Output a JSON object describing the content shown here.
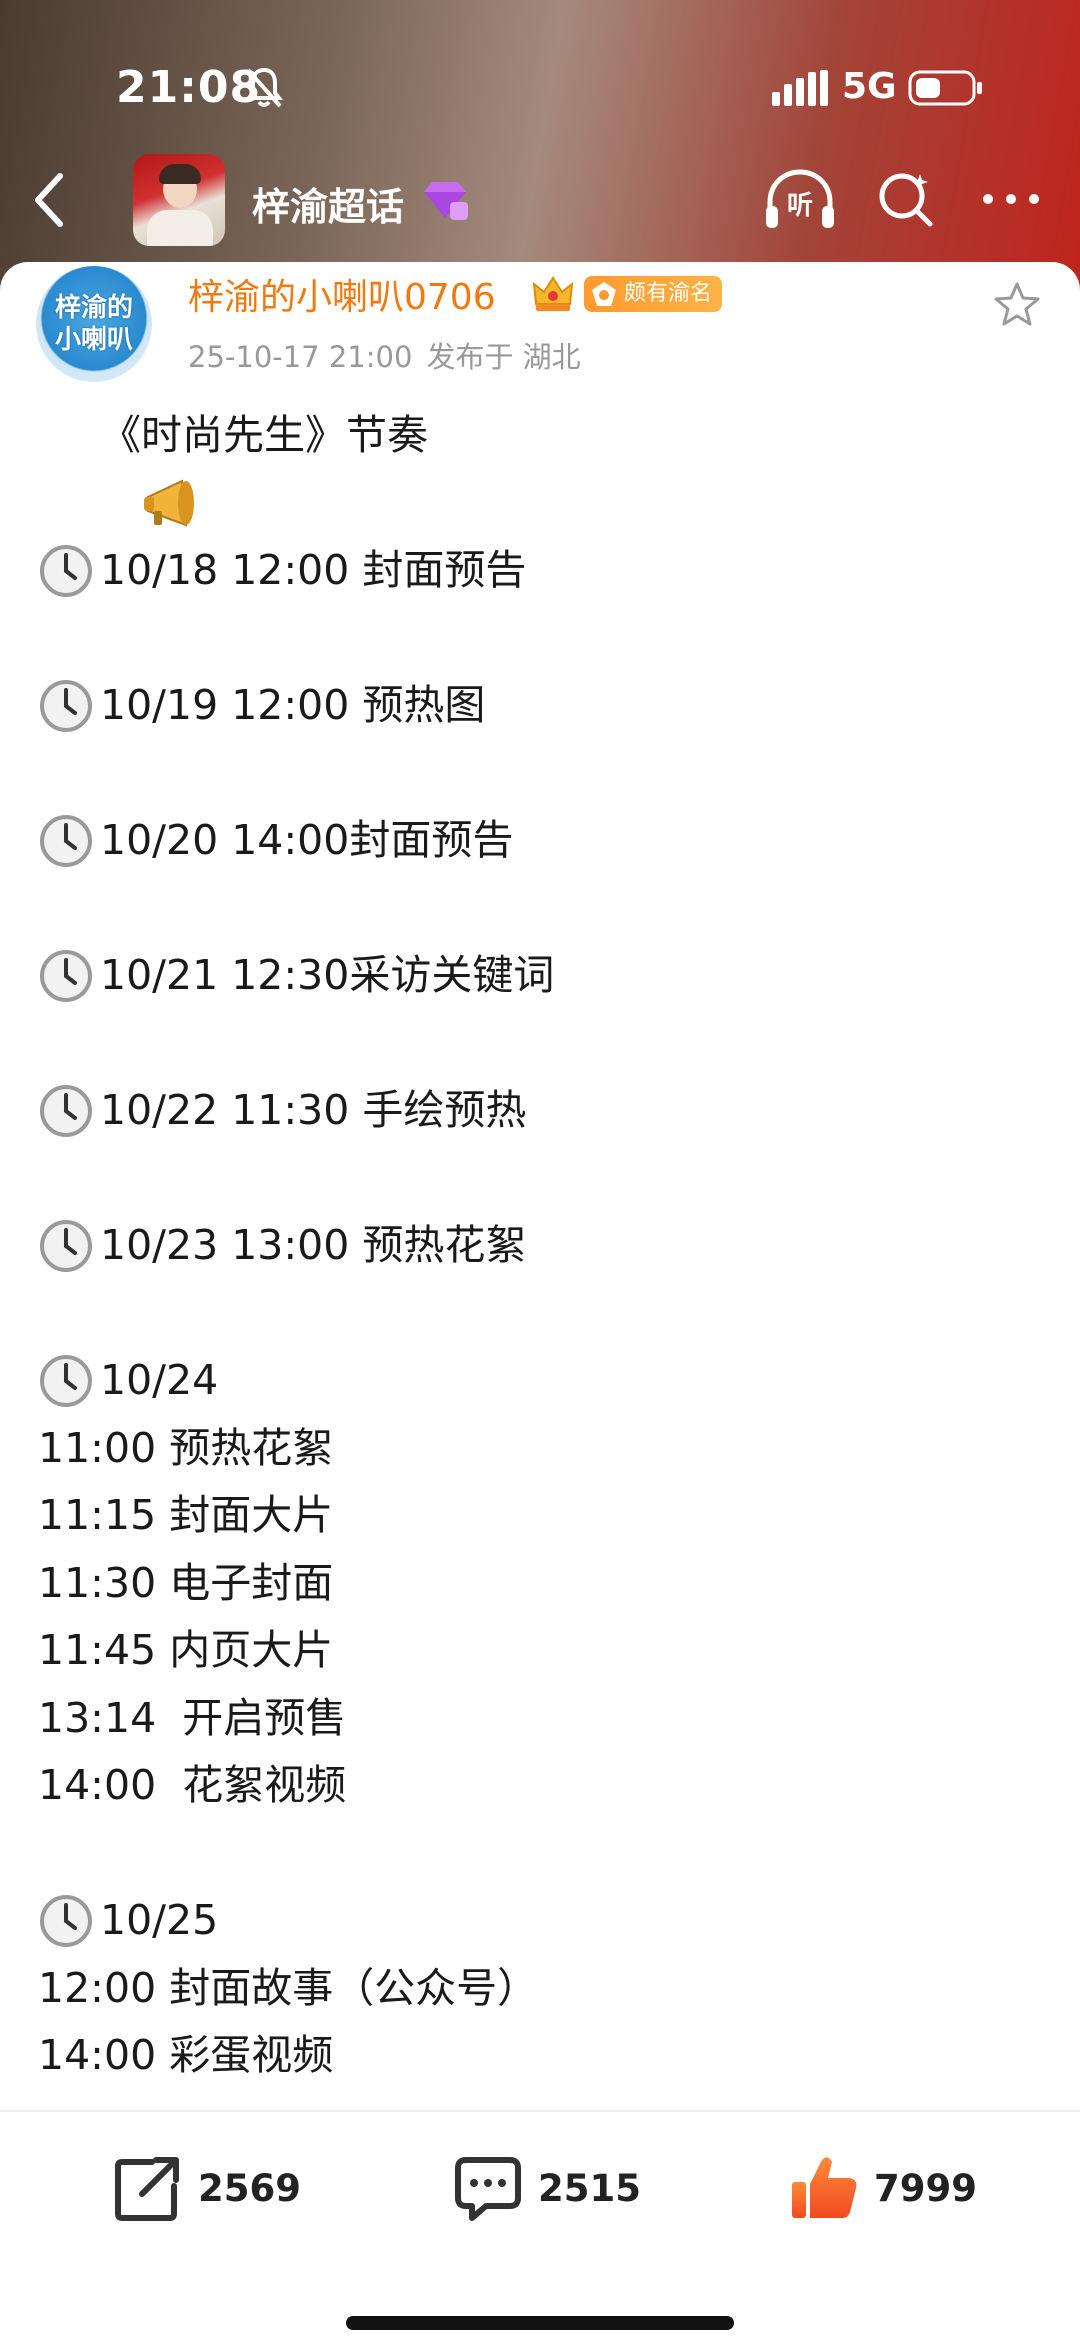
{
  "status_bar": {
    "time": "21:08",
    "network": "5G",
    "icons": [
      "bell-off-icon",
      "signal-icon",
      "battery-icon"
    ]
  },
  "nav": {
    "title": "梓渝超话",
    "icons": [
      "back-icon",
      "gem-badge-icon",
      "listen-icon",
      "search-icon",
      "more-icon"
    ],
    "listen_label": "听"
  },
  "post": {
    "author": {
      "name": "梓渝的小喇叭0706",
      "avatar_text": "梓渝的小喇叭",
      "badge": "颇有渝名"
    },
    "time": "25-10-17 21:00",
    "location": "发布于 湖北",
    "lines": {
      "l0": "《时尚先生》节奏",
      "l1": "10/18 12:00 封面预告",
      "l2": "10/19 12:00 预热图",
      "l3": "10/20 14:00封面预告",
      "l4": "10/21 12:30采访关键词",
      "l5": "10/22 11:30 手绘预热",
      "l6": "10/23 13:00 预热花絮",
      "l7": "10/24",
      "l8": "11:00 预热花絮",
      "l9": "11:15 封面大片",
      "l10": "11:30 电子封面",
      "l11": "11:45 内页大片",
      "l12": "13:14  开启预售",
      "l13": "14:00  花絮视频",
      "l14": "10/25",
      "l15": "12:00 封面故事（公众号）",
      "l16": "14:00 彩蛋视频"
    }
  },
  "actions": {
    "share_count": "2569",
    "comment_count": "2515",
    "like_count": "7999"
  },
  "colors": {
    "author_name": "#f07a10",
    "badge": "#ff9a2e",
    "like": "#f4622a"
  }
}
